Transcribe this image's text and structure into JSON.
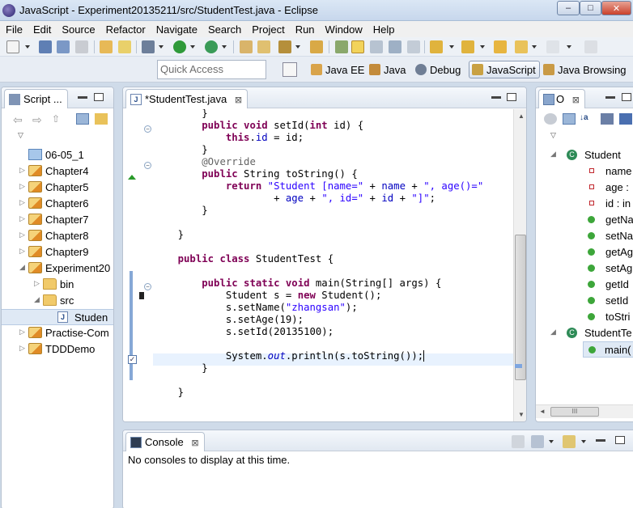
{
  "window": {
    "title": "JavaScript - Experiment20135211/src/StudentTest.java - Eclipse",
    "min_label": "–",
    "max_label": "□",
    "close_label": "✕"
  },
  "menu": [
    "File",
    "Edit",
    "Source",
    "Refactor",
    "Navigate",
    "Search",
    "Project",
    "Run",
    "Window",
    "Help"
  ],
  "quick_access": {
    "placeholder": "Quick Access"
  },
  "perspectives": [
    {
      "label": "Java EE",
      "icon": "java-ee-icon",
      "active": false
    },
    {
      "label": "Java",
      "icon": "java-icon",
      "active": false
    },
    {
      "label": "Debug",
      "icon": "debug-icon",
      "active": false
    },
    {
      "label": "JavaScript",
      "icon": "javascript-icon",
      "active": true
    },
    {
      "label": "Java Browsing",
      "icon": "java-browsing-icon",
      "active": false
    }
  ],
  "script_explorer": {
    "tab_label": "Script ...",
    "items": [
      {
        "label": "06-05_1",
        "type": "working-set",
        "indent": 0,
        "expanded": null
      },
      {
        "label": "Chapter4",
        "type": "project",
        "indent": 0,
        "expanded": false
      },
      {
        "label": "Chapter5",
        "type": "project",
        "indent": 0,
        "expanded": false
      },
      {
        "label": "Chapter6",
        "type": "project",
        "indent": 0,
        "expanded": false
      },
      {
        "label": "Chapter7",
        "type": "project",
        "indent": 0,
        "expanded": false
      },
      {
        "label": "Chapter8",
        "type": "project",
        "indent": 0,
        "expanded": false
      },
      {
        "label": "Chapter9",
        "type": "project",
        "indent": 0,
        "expanded": false
      },
      {
        "label": "Experiment20",
        "type": "project",
        "indent": 0,
        "expanded": true
      },
      {
        "label": "bin",
        "type": "folder",
        "indent": 1,
        "expanded": false
      },
      {
        "label": "src",
        "type": "folder",
        "indent": 1,
        "expanded": true
      },
      {
        "label": "Studen",
        "type": "file",
        "indent": 2,
        "expanded": null
      },
      {
        "label": "Practise-Com",
        "type": "project",
        "indent": 0,
        "expanded": false
      },
      {
        "label": "TDDDemo",
        "type": "project",
        "indent": 0,
        "expanded": false
      }
    ]
  },
  "editor": {
    "tab_label": "*StudentTest.java",
    "tab_close": "⊠",
    "lines": [
      [
        {
          "t": "        }",
          "c": ""
        }
      ],
      [
        {
          "t": "        ",
          "c": ""
        },
        {
          "t": "public void",
          "c": "kw"
        },
        {
          "t": " setId(",
          "c": ""
        },
        {
          "t": "int",
          "c": "kw"
        },
        {
          "t": " id) {",
          "c": ""
        }
      ],
      [
        {
          "t": "            ",
          "c": ""
        },
        {
          "t": "this",
          "c": "kw"
        },
        {
          "t": ".",
          "c": ""
        },
        {
          "t": "id",
          "c": "fld"
        },
        {
          "t": " = id;",
          "c": ""
        }
      ],
      [
        {
          "t": "        }",
          "c": ""
        }
      ],
      [
        {
          "t": "        ",
          "c": ""
        },
        {
          "t": "@Override",
          "c": "ann"
        }
      ],
      [
        {
          "t": "        ",
          "c": ""
        },
        {
          "t": "public",
          "c": "kw"
        },
        {
          "t": " String toString() {",
          "c": ""
        }
      ],
      [
        {
          "t": "            ",
          "c": ""
        },
        {
          "t": "return",
          "c": "kw"
        },
        {
          "t": " ",
          "c": ""
        },
        {
          "t": "\"Student [name=\"",
          "c": "str"
        },
        {
          "t": " + ",
          "c": ""
        },
        {
          "t": "name",
          "c": "fld"
        },
        {
          "t": " + ",
          "c": ""
        },
        {
          "t": "\", age()=\"",
          "c": "str"
        }
      ],
      [
        {
          "t": "                    + ",
          "c": ""
        },
        {
          "t": "age",
          "c": "fld"
        },
        {
          "t": " + ",
          "c": ""
        },
        {
          "t": "\", id=\"",
          "c": "str"
        },
        {
          "t": " + ",
          "c": ""
        },
        {
          "t": "id",
          "c": "fld"
        },
        {
          "t": " + ",
          "c": ""
        },
        {
          "t": "\"]\"",
          "c": "str"
        },
        {
          "t": ";",
          "c": ""
        }
      ],
      [
        {
          "t": "        }",
          "c": ""
        }
      ],
      [
        {
          "t": "",
          "c": ""
        }
      ],
      [
        {
          "t": "    }",
          "c": ""
        }
      ],
      [
        {
          "t": "",
          "c": ""
        }
      ],
      [
        {
          "t": "    ",
          "c": ""
        },
        {
          "t": "public class",
          "c": "kw"
        },
        {
          "t": " StudentTest {",
          "c": ""
        }
      ],
      [
        {
          "t": "",
          "c": ""
        }
      ],
      [
        {
          "t": "        ",
          "c": ""
        },
        {
          "t": "public static void",
          "c": "kw"
        },
        {
          "t": " main(String[] args) {",
          "c": ""
        }
      ],
      [
        {
          "t": "            Student s = ",
          "c": ""
        },
        {
          "t": "new",
          "c": "kw"
        },
        {
          "t": " Student();",
          "c": ""
        }
      ],
      [
        {
          "t": "            s.setName(",
          "c": ""
        },
        {
          "t": "\"zhangsan\"",
          "c": "str"
        },
        {
          "t": ");",
          "c": ""
        }
      ],
      [
        {
          "t": "            s.setAge(19);",
          "c": ""
        }
      ],
      [
        {
          "t": "            s.setId(20135100);",
          "c": ""
        }
      ],
      [
        {
          "t": "",
          "c": ""
        }
      ],
      [
        {
          "t": "            System.",
          "c": ""
        },
        {
          "t": "out",
          "c": "stat"
        },
        {
          "t": ".println(s.toString());",
          "c": ""
        }
      ],
      [
        {
          "t": "        }",
          "c": ""
        }
      ],
      [
        {
          "t": "",
          "c": ""
        }
      ],
      [
        {
          "t": "    }",
          "c": ""
        }
      ]
    ]
  },
  "outline": {
    "tab_label": "O",
    "items": [
      {
        "label": "Student",
        "kind": "class",
        "indent": 0
      },
      {
        "label": "name",
        "kind": "field",
        "indent": 1
      },
      {
        "label": "age :",
        "kind": "field",
        "indent": 1
      },
      {
        "label": "id : in",
        "kind": "field",
        "indent": 1
      },
      {
        "label": "getNa",
        "kind": "method",
        "indent": 1
      },
      {
        "label": "setNa",
        "kind": "method",
        "indent": 1
      },
      {
        "label": "getAg",
        "kind": "method",
        "indent": 1
      },
      {
        "label": "setAg",
        "kind": "method",
        "indent": 1
      },
      {
        "label": "getId",
        "kind": "method",
        "indent": 1
      },
      {
        "label": "setId",
        "kind": "method",
        "indent": 1
      },
      {
        "label": "toStri",
        "kind": "method",
        "indent": 1
      },
      {
        "label": "StudentTe",
        "kind": "class",
        "indent": 0
      },
      {
        "label": "main(",
        "kind": "method-static",
        "indent": 1
      }
    ],
    "hscroll_label": "III"
  },
  "console": {
    "tab_label": "Console",
    "message": "No consoles to display at this time."
  }
}
